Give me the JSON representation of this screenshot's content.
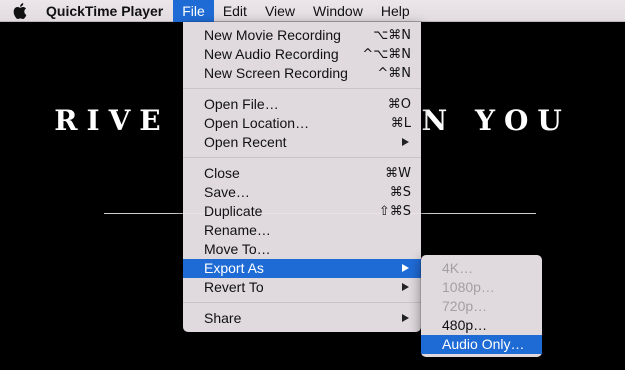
{
  "menubar": {
    "app_name": "QuickTime Player",
    "menus": [
      "File",
      "Edit",
      "View",
      "Window",
      "Help"
    ],
    "active_menu": "File"
  },
  "video": {
    "title_left": "RIVE",
    "title_right": "N YOU"
  },
  "file_menu": {
    "groups": [
      [
        {
          "label": "New Movie Recording",
          "shortcut": "⌥⌘N"
        },
        {
          "label": "New Audio Recording",
          "shortcut": "^⌥⌘N"
        },
        {
          "label": "New Screen Recording",
          "shortcut": "^⌘N"
        }
      ],
      [
        {
          "label": "Open File…",
          "shortcut": "⌘O"
        },
        {
          "label": "Open Location…",
          "shortcut": "⌘L"
        },
        {
          "label": "Open Recent",
          "submenu": true
        }
      ],
      [
        {
          "label": "Close",
          "shortcut": "⌘W"
        },
        {
          "label": "Save…",
          "shortcut": "⌘S"
        },
        {
          "label": "Duplicate",
          "shortcut": "⇧⌘S"
        },
        {
          "label": "Rename…"
        },
        {
          "label": "Move To…"
        },
        {
          "label": "Export As",
          "submenu": true,
          "highlighted": true
        },
        {
          "label": "Revert To",
          "submenu": true
        }
      ],
      [
        {
          "label": "Share",
          "submenu": true
        }
      ]
    ]
  },
  "export_menu": {
    "items": [
      {
        "label": "4K…",
        "enabled": false
      },
      {
        "label": "1080p…",
        "enabled": false
      },
      {
        "label": "720p…",
        "enabled": false
      },
      {
        "label": "480p…",
        "enabled": true
      },
      {
        "label": "Audio Only…",
        "enabled": true,
        "highlighted": true
      }
    ]
  },
  "colors": {
    "highlight": "#1f6bd6",
    "menu_bg": "#e8e2e6",
    "disabled_text": "#a49fa3"
  }
}
